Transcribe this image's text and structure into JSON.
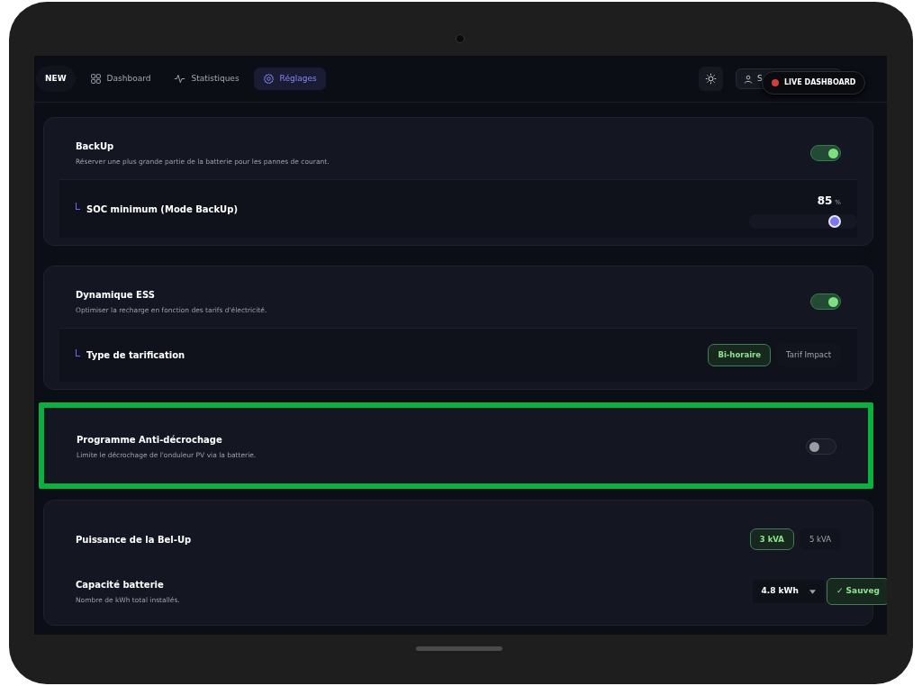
{
  "nav": {
    "badge": "NEW",
    "tabs": [
      {
        "label": "Dashboard",
        "selected": false
      },
      {
        "label": "Statistiques",
        "selected": false
      },
      {
        "label": "Réglages",
        "selected": true
      }
    ],
    "user_button": {
      "label": "S"
    }
  },
  "live_badge": {
    "label": "LIVE DASHBOARD"
  },
  "sections": [
    {
      "highlighted": false,
      "rows": [
        {
          "kind": "toggle",
          "title": "BackUp",
          "description": "Réserver une plus grande partie de la batterie pour les pannes de courant.",
          "on": true
        },
        {
          "kind": "slider",
          "sub": true,
          "title": "SOC minimum (Mode BackUp)",
          "value": "85",
          "unit": "%",
          "level": 0.85
        }
      ]
    },
    {
      "highlighted": false,
      "rows": [
        {
          "kind": "toggle",
          "title": "Dynamique ESS",
          "description": "Optimiser la recharge en fonction des tarifs d'électricité.",
          "on": true
        },
        {
          "kind": "segmented",
          "sub": true,
          "title": "Type de tarification",
          "options": [
            {
              "label": "Bi-horaire",
              "selected": true
            },
            {
              "label": "Tarif Impact",
              "selected": false
            }
          ]
        }
      ]
    },
    {
      "highlighted": true,
      "rows": [
        {
          "kind": "toggle",
          "title": "Programme Anti-décrochage",
          "description": "Limite le décrochage de l'onduleur PV via la batterie.",
          "on": false
        }
      ]
    },
    {
      "highlighted": false,
      "rows": [
        {
          "kind": "segmented",
          "title": "Puissance de la Bel-Up",
          "options": [
            {
              "label": "3 kVA",
              "selected": true
            },
            {
              "label": "5 kVA",
              "selected": false
            }
          ]
        },
        {
          "kind": "select",
          "title": "Capacité batterie",
          "description": "Nombre de kWh total installés.",
          "value": "4.8 kWh",
          "button": "✓ Sauveg"
        }
      ]
    }
  ]
}
